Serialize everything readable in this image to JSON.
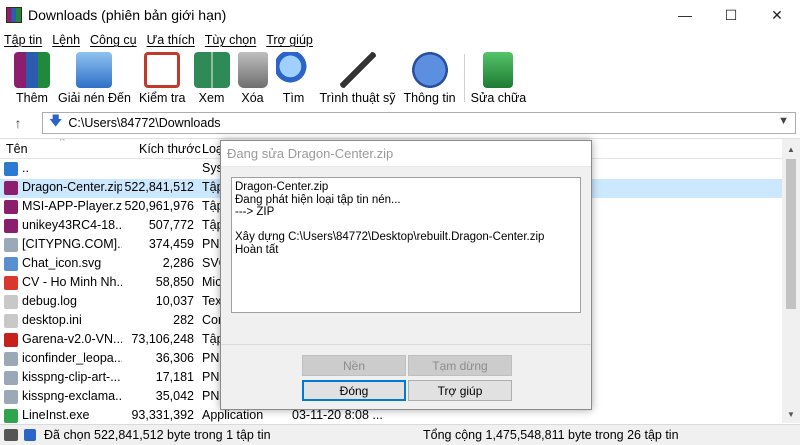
{
  "window": {
    "title": "Downloads (phiên bản giới hạn)",
    "minimize": "—",
    "maximize": "☐",
    "close": "✕"
  },
  "menu": [
    "Tập tin",
    "Lệnh",
    "Công cụ",
    "Ưa thích",
    "Tùy chọn",
    "Trợ giúp"
  ],
  "toolbar": [
    {
      "label": "Thêm",
      "icon": "winrar-books-icon",
      "color": "#8b1f6e"
    },
    {
      "label": "Giải nén Đến",
      "icon": "extract-folder-icon",
      "color": "#3a7bd5"
    },
    {
      "label": "Kiểm tra",
      "icon": "test-checklist-icon",
      "color": "#c0392b"
    },
    {
      "label": "Xem",
      "icon": "view-book-icon",
      "color": "#2e8b57"
    },
    {
      "label": "Xóa",
      "icon": "trash-icon",
      "color": "#7a7a7a"
    },
    {
      "label": "Tìm",
      "icon": "magnifier-icon",
      "color": "#2b63c6"
    },
    {
      "label": "Trình thuật sỹ",
      "icon": "wizard-wand-icon",
      "color": "#6a4fb3"
    },
    {
      "label": "Thông tin",
      "icon": "info-icon",
      "color": "#2b63c6"
    },
    {
      "label": "Sửa chữa",
      "icon": "repair-kit-icon",
      "color": "#2e9e44"
    }
  ],
  "path": {
    "value": "C:\\Users\\84772\\Downloads",
    "up": "↑",
    "dropdown": "▼"
  },
  "columns": {
    "name": "Tên",
    "size": "Kích thước",
    "type": "Loại",
    "sort_glyph": "^"
  },
  "files": [
    {
      "name": "..",
      "size": "",
      "type": "Sys",
      "color": "#2b7bd0"
    },
    {
      "name": "Dragon-Center.zip",
      "size": "522,841,512",
      "type": "Tập",
      "color": "#8b1f6e",
      "selected": true
    },
    {
      "name": "MSI-APP-Player.z...",
      "size": "520,961,976",
      "type": "Tập",
      "color": "#8b1f6e"
    },
    {
      "name": "unikey43RC4-18...",
      "size": "507,772",
      "type": "Tập",
      "color": "#8b1f6e"
    },
    {
      "name": "[CITYPNG.COM]...",
      "size": "374,459",
      "type": "PNG",
      "color": "#9aa8b8"
    },
    {
      "name": "Chat_icon.svg",
      "size": "2,286",
      "type": "SVG",
      "color": "#5a8fd0"
    },
    {
      "name": "CV - Ho Minh Nh...",
      "size": "58,850",
      "type": "Mic",
      "color": "#d9382f"
    },
    {
      "name": "debug.log",
      "size": "10,037",
      "type": "Tex",
      "color": "#c8c8c8"
    },
    {
      "name": "desktop.ini",
      "size": "282",
      "type": "Cor",
      "color": "#c8c8c8"
    },
    {
      "name": "Garena-v2.0-VN...",
      "size": "73,106,248",
      "type": "Tập",
      "color": "#c8201a"
    },
    {
      "name": "iconfinder_leopa...",
      "size": "36,306",
      "type": "PNG",
      "color": "#9aa8b8"
    },
    {
      "name": "kisspng-clip-art-...",
      "size": "17,181",
      "type": "PNG",
      "color": "#9aa8b8"
    },
    {
      "name": "kisspng-exclama...",
      "size": "35,042",
      "type": "PNG",
      "color": "#9aa8b8"
    },
    {
      "name": "LineInst.exe",
      "size": "93,331,392",
      "type": "Application",
      "color": "#2ea44f",
      "date": "03-11-20 8:08 ..."
    }
  ],
  "status": {
    "left": "Đã chọn 522,841,512 byte trong 1 tập tin",
    "right": "Tổng cộng 1,475,548,811 byte trong 26 tập tin"
  },
  "dialog": {
    "title": "Đang sửa Dragon-Center.zip",
    "log": [
      "Dragon-Center.zip",
      "Đang phát hiện loại tập tin nén...",
      "---> ZIP",
      "",
      "Xây dựng C:\\Users\\84772\\Desktop\\rebuilt.Dragon-Center.zip",
      "Hoàn tất"
    ],
    "buttons": {
      "background": "Nền",
      "pause": "Tạm dừng",
      "close": "Đóng",
      "help": "Trợ giúp"
    }
  }
}
